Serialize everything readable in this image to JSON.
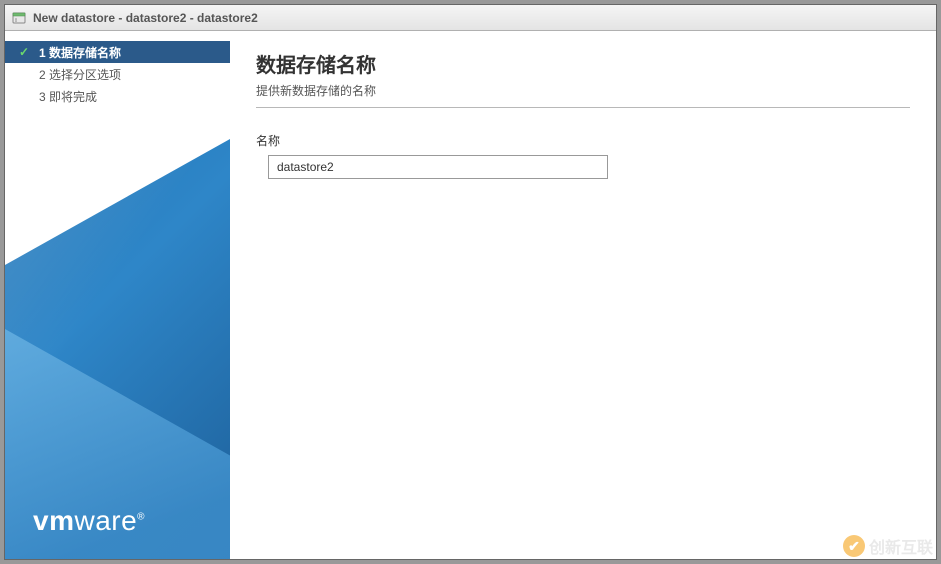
{
  "titlebar": {
    "title": "New datastore - datastore2 - datastore2"
  },
  "sidebar": {
    "steps": [
      {
        "num": "1",
        "label": "数据存储名称"
      },
      {
        "num": "2",
        "label": "选择分区选项"
      },
      {
        "num": "3",
        "label": "即将完成"
      }
    ],
    "logo_bold": "vm",
    "logo_rest": "ware",
    "logo_tm": "®"
  },
  "content": {
    "title": "数据存储名称",
    "subtitle": "提供新数据存储的名称",
    "name_label": "名称",
    "name_value": "datastore2"
  },
  "watermark": {
    "text": "创新互联"
  }
}
